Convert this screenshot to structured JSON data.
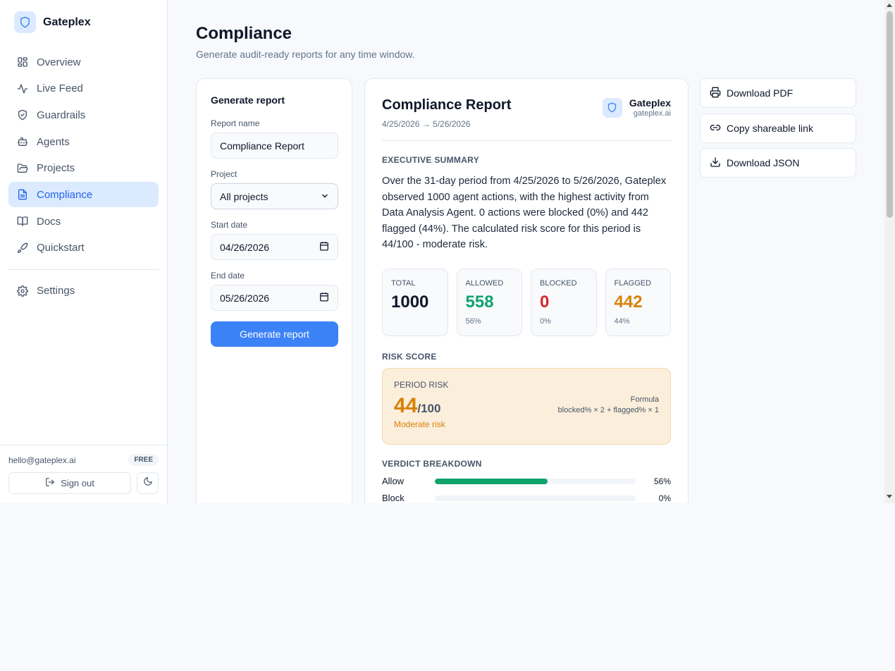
{
  "brand": {
    "name": "Gateplex"
  },
  "sidebar": {
    "items": [
      {
        "label": "Overview",
        "icon": "layout-grid-icon"
      },
      {
        "label": "Live Feed",
        "icon": "activity-icon"
      },
      {
        "label": "Guardrails",
        "icon": "shield-check-icon"
      },
      {
        "label": "Agents",
        "icon": "bot-icon"
      },
      {
        "label": "Projects",
        "icon": "folder-open-icon"
      },
      {
        "label": "Compliance",
        "icon": "file-text-icon",
        "active": true
      },
      {
        "label": "Docs",
        "icon": "book-open-icon"
      },
      {
        "label": "Quickstart",
        "icon": "rocket-icon"
      }
    ],
    "settings_label": "Settings",
    "user_email": "hello@gateplex.ai",
    "plan_badge": "FREE",
    "signout_label": "Sign out"
  },
  "page": {
    "title": "Compliance",
    "subtitle": "Generate audit-ready reports for any time window."
  },
  "form": {
    "title": "Generate report",
    "report_name_label": "Report name",
    "report_name_value": "Compliance Report",
    "project_label": "Project",
    "project_value": "All projects",
    "start_label": "Start date",
    "start_value": "04/26/2026",
    "end_label": "End date",
    "end_value": "05/26/2026",
    "submit_label": "Generate report"
  },
  "report": {
    "title": "Compliance Report",
    "range": "4/25/2026 → 5/26/2026",
    "brand_name": "Gateplex",
    "brand_domain": "gateplex.ai",
    "summary_label": "EXECUTIVE SUMMARY",
    "summary_text": "Over the 31-day period from 4/25/2026 to 5/26/2026, Gateplex observed 1000 agent actions, with the highest activity from Data Analysis Agent. 0 actions were blocked (0%) and 442 flagged (44%). The calculated risk score for this period is 44/100 - moderate risk.",
    "stats": [
      {
        "label": "TOTAL",
        "value": "1000",
        "pct": "",
        "color": "#0f172a"
      },
      {
        "label": "ALLOWED",
        "value": "558",
        "pct": "56%",
        "color": "#10a36c"
      },
      {
        "label": "BLOCKED",
        "value": "0",
        "pct": "0%",
        "color": "#dc2626"
      },
      {
        "label": "FLAGGED",
        "value": "442",
        "pct": "44%",
        "color": "#d98208"
      }
    ],
    "risk_section_label": "RISK SCORE",
    "risk_box_label": "PERIOD RISK",
    "risk_score": "44",
    "risk_max": "/100",
    "risk_level": "Moderate risk",
    "formula_label": "Formula",
    "formula_text": "blocked% × 2 + flagged% × 1",
    "breakdown_label": "VERDICT BREAKDOWN",
    "breakdown": [
      {
        "label": "Allow",
        "pct_text": "56%",
        "fraction": 0.56
      },
      {
        "label": "Block",
        "pct_text": "0%",
        "fraction": 0.0
      }
    ]
  },
  "actions": {
    "download_pdf": "Download PDF",
    "copy_link": "Copy shareable link",
    "download_json": "Download JSON"
  },
  "colors": {
    "accent": "#3b82f6",
    "active_bg": "#dbeafe",
    "allow": "#10a36c",
    "block": "#dc2626",
    "flag": "#d98208"
  }
}
